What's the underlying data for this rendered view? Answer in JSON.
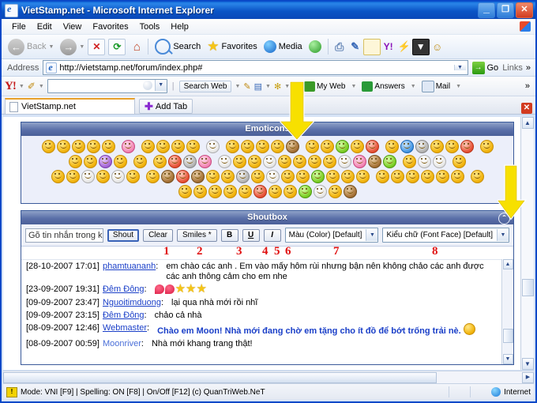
{
  "window": {
    "title": "VietStamp.net - Microsoft Internet Explorer",
    "minimize": "_",
    "maximize": "❐",
    "close": "✕"
  },
  "menu": {
    "items": [
      "File",
      "Edit",
      "View",
      "Favorites",
      "Tools",
      "Help"
    ]
  },
  "toolbar": {
    "back": "Back",
    "forward": "",
    "stop": "✕",
    "refresh": "⟳",
    "home": "⌂",
    "search": "Search",
    "favorites": "Favorites",
    "media": "Media",
    "history": "",
    "mail": "",
    "print": "",
    "edit": "",
    "discuss": ""
  },
  "address": {
    "label": "Address",
    "url": "http://vietstamp.net/forum/index.php#",
    "go": "Go",
    "links": "Links",
    "overflow": "»"
  },
  "yahoo_bar": {
    "logo": "Y!",
    "search_value": "",
    "search_button": "Search Web",
    "my_web": "My Web",
    "answers": "Answers",
    "mail": "Mail",
    "overflow": "»"
  },
  "tabs": {
    "items": [
      {
        "label": "VietStamp.net"
      }
    ],
    "add_tab": "Add Tab",
    "close": "✕"
  },
  "emoticons": {
    "title": "Emoticons",
    "rows": [
      [
        "y",
        "y",
        "y",
        "y",
        "y",
        "sp-pink",
        "sp-y",
        "y",
        "y",
        "y",
        "sp-white",
        "sp-y",
        "y",
        "y",
        "y",
        "brown",
        "sp-y",
        "y",
        "green",
        "y",
        "red",
        "sp-y",
        "blue",
        "grey",
        "y",
        "y",
        "red",
        "sp-y"
      ],
      [
        "y",
        "y",
        "purple",
        "y",
        "sp-y",
        "sp-y",
        "red",
        "grey",
        "pink",
        "sp-white",
        "y",
        "y",
        "white",
        "y",
        "y",
        "y",
        "y",
        "white",
        "pink",
        "brown",
        "green",
        "sp-y",
        "white",
        "white",
        "sp-y"
      ],
      [
        "y",
        "y",
        "white",
        "y",
        "white",
        "y",
        "sp-y",
        "brown",
        "red",
        "brown",
        "y",
        "y",
        "grey",
        "y",
        "white",
        "y",
        "y",
        "green",
        "y",
        "y",
        "y",
        "sp-y",
        "y",
        "y",
        "y",
        "y",
        "y",
        "sp-y"
      ],
      [
        "y",
        "y",
        "y",
        "y",
        "y",
        "red",
        "y",
        "y",
        "green",
        "white",
        "y",
        "brown"
      ]
    ]
  },
  "shoutbox": {
    "title": "Shoutbox",
    "collapse_icon": "collapse-icon",
    "input_placeholder": "Gõ tin nhắn trong khung này",
    "input_value": "",
    "buttons": {
      "shout": "Shout",
      "clear": "Clear",
      "smiles": "Smiles *",
      "bold": "B",
      "underline": "U",
      "italic": "I"
    },
    "color_select": "Màu (Color) [Default]",
    "font_select": "Kiểu chữ (Font Face) [Default]",
    "markers": [
      "1",
      "2",
      "3",
      "4",
      "5",
      "6",
      "7",
      "8"
    ],
    "messages": [
      {
        "timestamp": "[28-10-2007 17:01]",
        "user": "phamtuananh",
        "user_link": true,
        "text": "em chào các anh . Em vào mấy hôm rùi nhưng bận nên không chảo các anh được các anh thông cảm cho em nhe",
        "highlight": false
      },
      {
        "timestamp": "[23-09-2007 19:31]",
        "user": "Đêm Đông",
        "user_link": true,
        "text": "",
        "emoji": "rose-rose-star-star-star",
        "highlight": false
      },
      {
        "timestamp": "[09-09-2007 23:47]",
        "user": "Nguoitimduong",
        "user_link": true,
        "text": "lại qua nhà mới rồi nhĩ",
        "highlight": false
      },
      {
        "timestamp": "[09-09-2007 23:15]",
        "user": "Đêm Đông",
        "user_link": true,
        "text": "chảo cả nhà",
        "highlight": false
      },
      {
        "timestamp": "[08-09-2007 12:46]",
        "user": "Webmaster",
        "user_link": true,
        "text": "Chào em Moon! Nhà mới đang chờ em tặng cho ít đồ để bớt trống trải nè.",
        "highlight": true,
        "trailing_emoticon": true
      },
      {
        "timestamp": "[08-09-2007 00:59]",
        "user": "Moonriver",
        "user_link": false,
        "text": "Nhà mới khang trang thật!",
        "highlight": false
      }
    ]
  },
  "status_bar": {
    "text": "Mode: VNI [F9] | Spelling: ON [F8] | On/Off [F12] (c) QuanTriWeb.NeT",
    "zone": "Internet",
    "warn_icon": "!"
  },
  "colors": {
    "title_blue": "#0a54c6",
    "panel_header": "#5a6fa8",
    "marker_red": "#e01010",
    "link_blue": "#1a3fc8",
    "arrow_yellow": "#f5e000"
  }
}
